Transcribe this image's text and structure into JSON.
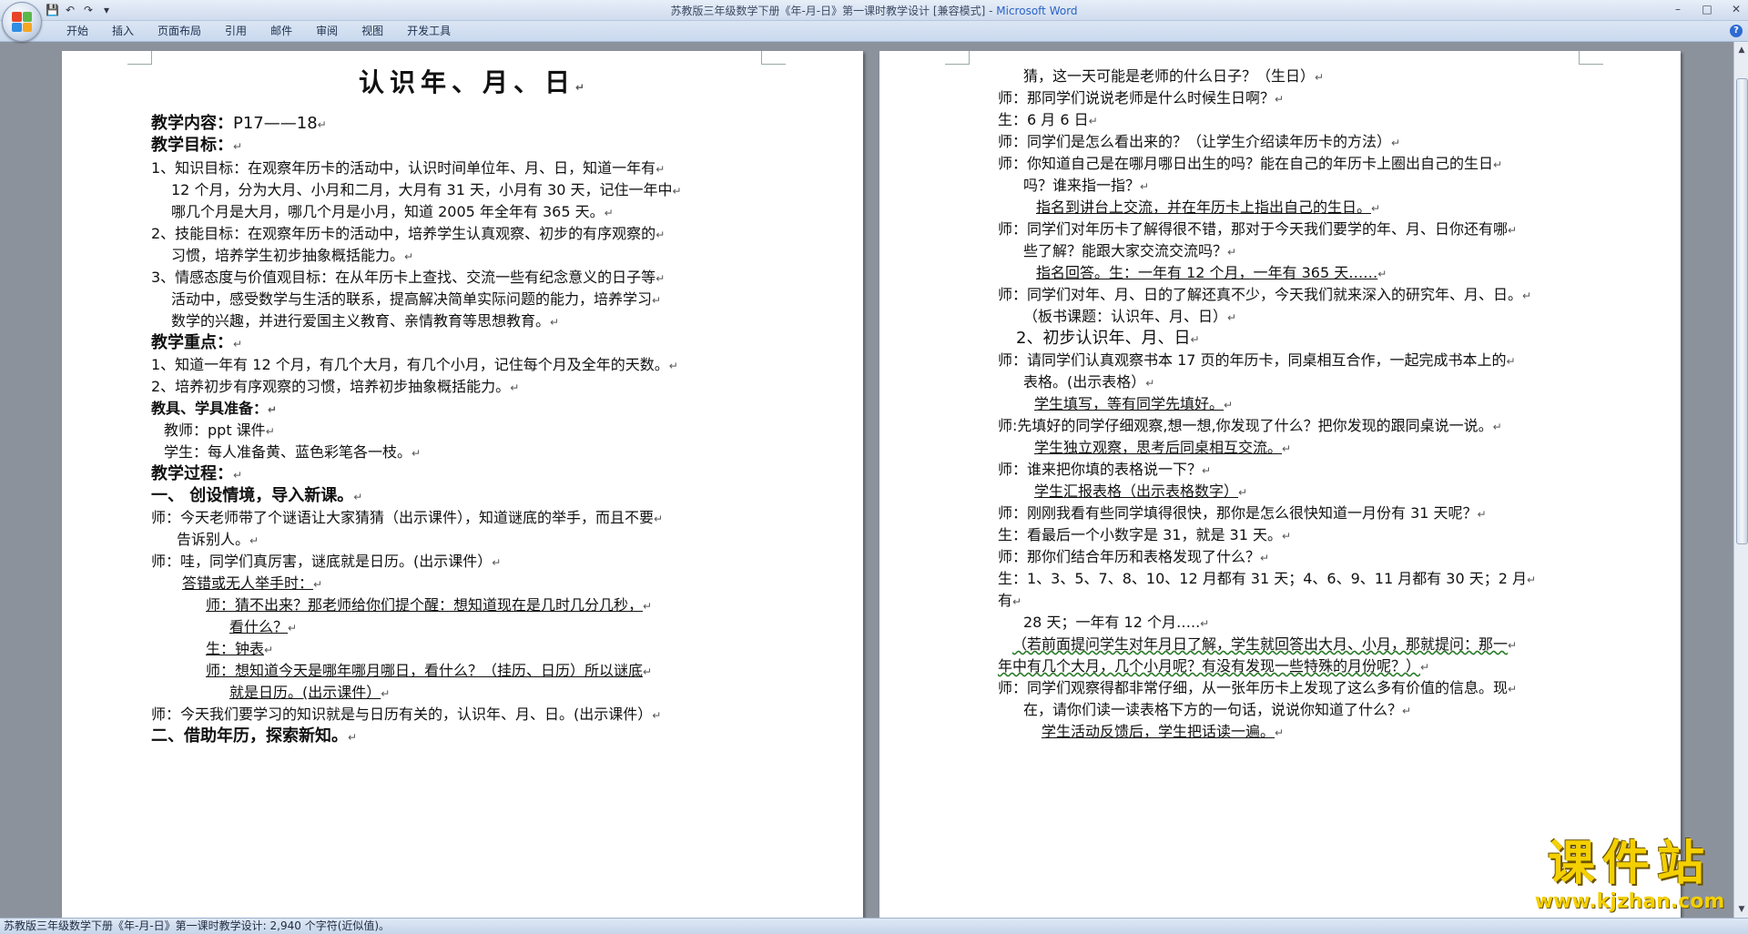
{
  "window": {
    "doc_title": "苏教版三年级数学下册《年-月-日》第一课时教学设计 [兼容模式] - ",
    "app_name": "Microsoft Word",
    "qat_icons": [
      "save-icon",
      "undo-icon",
      "redo-icon",
      "customize-icon"
    ]
  },
  "ribbon": {
    "tabs": [
      "开始",
      "插入",
      "页面布局",
      "引用",
      "邮件",
      "审阅",
      "视图",
      "开发工具"
    ],
    "help": "?"
  },
  "left_page": {
    "title": "认识年、月、日",
    "lines": [
      {
        "parts": [
          {
            "t": "教学内容：",
            "b": true
          },
          {
            "t": "P17——18"
          }
        ]
      },
      {
        "parts": [
          {
            "t": "教学目标：",
            "b": true
          }
        ]
      },
      {
        "parts": [
          {
            "t": "1、知识目标：在观察年历卡的活动中，认识时间单位年、月、日，知道一年有"
          }
        ]
      },
      {
        "parts": [
          {
            "t": "12 个月，分为大月、小月和二月，大月有 31 天，小月有 30 天，记住一年中"
          }
        ]
      },
      {
        "parts": [
          {
            "t": "哪几个月是大月，哪几个月是小月，知道 2005 年全年有 365 天。"
          }
        ]
      },
      {
        "parts": [
          {
            "t": "2、技能目标：在观察年历卡的活动中，培养学生认真观察、初步的有序观察的"
          }
        ]
      },
      {
        "parts": [
          {
            "t": "习惯，培养学生初步抽象概括能力。"
          }
        ]
      },
      {
        "parts": [
          {
            "t": "3、情感态度与价值观目标：在从年历卡上查找、交流一些有纪念意义的日子等"
          }
        ]
      },
      {
        "parts": [
          {
            "t": "活动中，感受数学与生活的联系，提高解决简单实际问题的能力，培养学习"
          }
        ]
      },
      {
        "parts": [
          {
            "t": "数学的兴趣，并进行爱国主义教育、亲情教育等思想教育。"
          }
        ]
      },
      {
        "parts": [
          {
            "t": "教学重点：",
            "b": true
          }
        ]
      },
      {
        "parts": [
          {
            "t": "1、知道一年有 12 个月，有几个大月，有几个小月，记住每个月及全年的天数。"
          }
        ]
      },
      {
        "parts": [
          {
            "t": "2、培养初步有序观察的习惯，培养初步抽象概括能力。"
          }
        ]
      },
      {
        "parts": [
          {
            "t": "教具、学具准备：",
            "b": true
          }
        ]
      },
      {
        "parts": [
          {
            "t": "教师：ppt 课件"
          }
        ]
      },
      {
        "parts": [
          {
            "t": "学生：每人准备黄、蓝色彩笔各一枝。"
          }
        ]
      },
      {
        "parts": [
          {
            "t": "教学过程：",
            "b": true
          }
        ]
      },
      {
        "parts": [
          {
            "t": "一、    创设情境，导入新课。",
            "b": true
          }
        ]
      },
      {
        "parts": [
          {
            "t": "师：今天老师带了个谜语让大家猜猜（出示课件），知道谜底的举手，而且不要"
          }
        ]
      },
      {
        "parts": [
          {
            "t": "告诉别人。"
          }
        ]
      },
      {
        "parts": [
          {
            "t": "师：哇，同学们真厉害，谜底就是日历。(出示课件）"
          }
        ]
      },
      {
        "parts": [
          {
            "t": "答错或无人举手时：",
            "u": true
          }
        ]
      },
      {
        "parts": [
          {
            "t": "师：猜不出来？那老师给你们提个醒：想知道现在是几时几分几秒，",
            "u": true
          }
        ]
      },
      {
        "parts": [
          {
            "t": "看什么？",
            "u": true
          }
        ]
      },
      {
        "parts": [
          {
            "t": "生：钟表",
            "u": true
          }
        ]
      },
      {
        "parts": [
          {
            "t": "师：想知道今天是哪年哪月哪日，看什么？（挂历、日历）所以谜底",
            "u": true
          }
        ]
      },
      {
        "parts": [
          {
            "t": "就是日历。(出示课件）",
            "u": true
          }
        ]
      },
      {
        "parts": [
          {
            "t": "师：今天我们要学习的知识就是与日历有关的，认识年、月、日。(出示课件）"
          }
        ]
      },
      {
        "parts": [
          {
            "t": "二、借助年历，探索新知。",
            "b": true
          }
        ]
      }
    ]
  },
  "right_page": {
    "lines": [
      {
        "parts": [
          {
            "t": "猜，这一天可能是老师的什么日子？（生日）"
          }
        ]
      },
      {
        "parts": [
          {
            "t": "师：那同学们说说老师是什么时候生日啊？"
          }
        ]
      },
      {
        "parts": [
          {
            "t": "生：6 月 6 日"
          }
        ]
      },
      {
        "parts": [
          {
            "t": "师：同学们是怎么看出来的？（让学生介绍读年历卡的方法）"
          }
        ]
      },
      {
        "parts": [
          {
            "t": "师：你知道自己是在哪月哪日出生的吗？能在自己的年历卡上圈出自己的生日"
          }
        ]
      },
      {
        "parts": [
          {
            "t": "吗？谁来指一指？"
          }
        ]
      },
      {
        "parts": [
          {
            "t": "指名到讲台上交流，并在年历卡上指出自己的生日。",
            "u": true
          }
        ]
      },
      {
        "parts": [
          {
            "t": "师：同学们对年历卡了解得很不错，那对于今天我们要学的年、月、日你还有哪"
          }
        ]
      },
      {
        "parts": [
          {
            "t": "些了解？能跟大家交流交流吗？"
          }
        ]
      },
      {
        "parts": [
          {
            "t": "指名回答。生：一年有 12 个月，一年有 365 天……",
            "u": true
          }
        ]
      },
      {
        "parts": [
          {
            "t": "师：同学们对年、月、日的了解还真不少，今天我们就来深入的研究年、月、日。"
          }
        ]
      },
      {
        "parts": [
          {
            "t": "（板书课题：认识年、月、日）"
          }
        ]
      },
      {
        "parts": [
          {
            "t": "2、初步认识年、月、日"
          }
        ]
      },
      {
        "parts": [
          {
            "t": "师：请同学们认真观察书本 17 页的年历卡，同桌相互合作，一起完成书本上的"
          }
        ]
      },
      {
        "parts": [
          {
            "t": "表格。(出示表格）"
          }
        ]
      },
      {
        "parts": [
          {
            "t": "学生填写，等有同学先填好。",
            "u": true
          }
        ]
      },
      {
        "parts": [
          {
            "t": "师:先填好的同学仔细观察,想一想,你发现了什么？把你发现的跟同桌说一说。"
          }
        ]
      },
      {
        "parts": [
          {
            "t": "学生独立观察，思考后同桌相互交流。",
            "u": true
          }
        ]
      },
      {
        "parts": [
          {
            "t": "师：谁来把你填的表格说一下？"
          }
        ]
      },
      {
        "parts": [
          {
            "t": "学生汇报表格（出示表格数字）",
            "u": true
          }
        ]
      },
      {
        "parts": [
          {
            "t": "师：刚刚我看有些同学填得很快，那你是怎么很快知道一月份有 31 天呢？"
          }
        ]
      },
      {
        "parts": [
          {
            "t": "生：看最后一个小数字是 31，就是 31 天。"
          }
        ]
      },
      {
        "parts": [
          {
            "t": "师：那你们结合年历和表格发现了什么？"
          }
        ]
      },
      {
        "parts": [
          {
            "t": "生：1、3、5、7、8、10、12 月都有 31 天；4、6、9、11 月都有 30 天；2 月"
          }
        ]
      },
      {
        "parts": [
          {
            "t": "有"
          }
        ]
      },
      {
        "parts": [
          {
            "t": "28 天；一年有 12 个月….."
          }
        ]
      },
      {
        "parts": [
          {
            "t": "（若前面提问学生对年月日了解，学生就回答出大月、小月，那就提问：那一",
            "w": true
          }
        ]
      },
      {
        "parts": [
          {
            "t": "年中有几个大月，几个小月呢？有没有发现一些特殊的月份呢？）",
            "w": true
          }
        ]
      },
      {
        "parts": [
          {
            "t": "师：同学们观察得都非常仔细，从一张年历卡上发现了这么多有价值的信息。现"
          }
        ]
      },
      {
        "parts": [
          {
            "t": "在，请你们读一读表格下方的一句话，说说你知道了什么？"
          }
        ]
      },
      {
        "parts": [
          {
            "t": "学生活动反馈后，学生把话读一遍。",
            "u": true
          }
        ]
      }
    ]
  },
  "status_bar": {
    "text": "苏教版三年级数学下册《年-月-日》第一课时教学设计: 2,940 个字符(近似值)。"
  },
  "watermark": {
    "title": "课件站",
    "url": "www.kjzhan.com"
  },
  "colors": {
    "office_logo": [
      "#e8442a",
      "#f5a623",
      "#2f8de4",
      "#5cb84a"
    ]
  }
}
